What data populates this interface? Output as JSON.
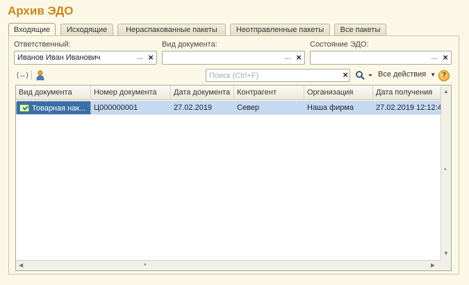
{
  "title": "Архив ЭДО",
  "tabs": [
    {
      "label": "Входящие",
      "active": true
    },
    {
      "label": "Исходящие",
      "active": false
    },
    {
      "label": "Нераспакованные пакеты",
      "active": false
    },
    {
      "label": "Неотправленные пакеты",
      "active": false
    },
    {
      "label": "Все пакеты",
      "active": false
    }
  ],
  "filters": {
    "responsible": {
      "label": "Ответственный:",
      "value": "Иванов Иван Иванович"
    },
    "doc_type": {
      "label": "Вид документа:",
      "value": ""
    },
    "edo_state": {
      "label": "Состояние ЭДО:",
      "value": ""
    },
    "select_glyph": "...",
    "clear_glyph": "×"
  },
  "toolbar": {
    "mark_glyph": "(↔)",
    "search_placeholder": "Поиск (Ctrl+F)",
    "search_icon": "search-icon",
    "actions_label": "Все действия",
    "help_glyph": "?"
  },
  "table": {
    "columns": [
      "Вид документа",
      "Номер документа",
      "Дата документа",
      "Контрагент",
      "Организация",
      "Дата получения"
    ],
    "rows": [
      [
        "Товарная нак...",
        "Ц000000001",
        "27.02.2019",
        "Север",
        "Наша фирма",
        "27.02.2019 12:12:4"
      ]
    ]
  },
  "colors": {
    "title": "#c8861b",
    "selected_row": "#c5d9f1",
    "background": "#fbf8e7"
  }
}
